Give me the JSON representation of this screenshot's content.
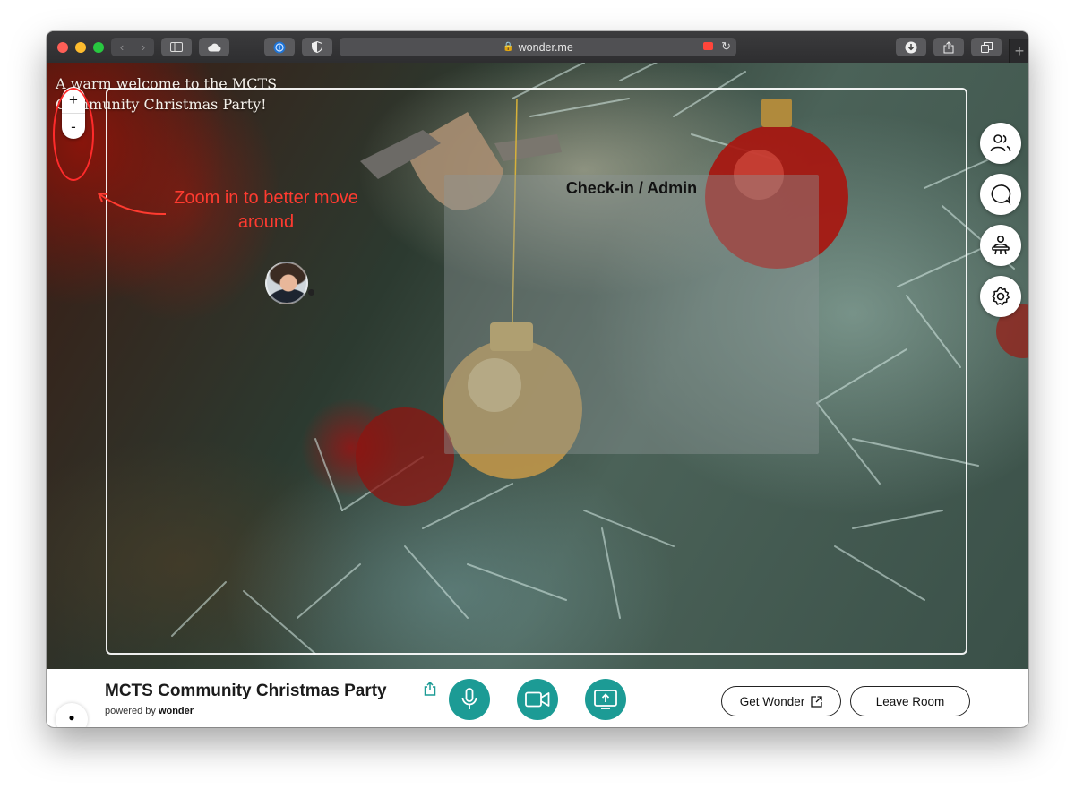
{
  "browser": {
    "url": "wonder.me"
  },
  "stage": {
    "welcome_text": "A warm welcome to the MCTS Community Christmas Party!",
    "zoom_in": "+",
    "zoom_out": "-",
    "annotation": "Zoom in to better move around",
    "room_title": "Check-in / Admin",
    "annotation_color": "#ff3b30"
  },
  "sidebar_icons": [
    "people-icon",
    "chat-icon",
    "host-icon",
    "settings-icon"
  ],
  "bottom": {
    "party_title": "MCTS Community Christmas Party",
    "powered_prefix": "powered by",
    "powered_brand": "wonder",
    "get_wonder": "Get Wonder",
    "leave_room": "Leave Room",
    "accent_color": "#1c9b95"
  }
}
